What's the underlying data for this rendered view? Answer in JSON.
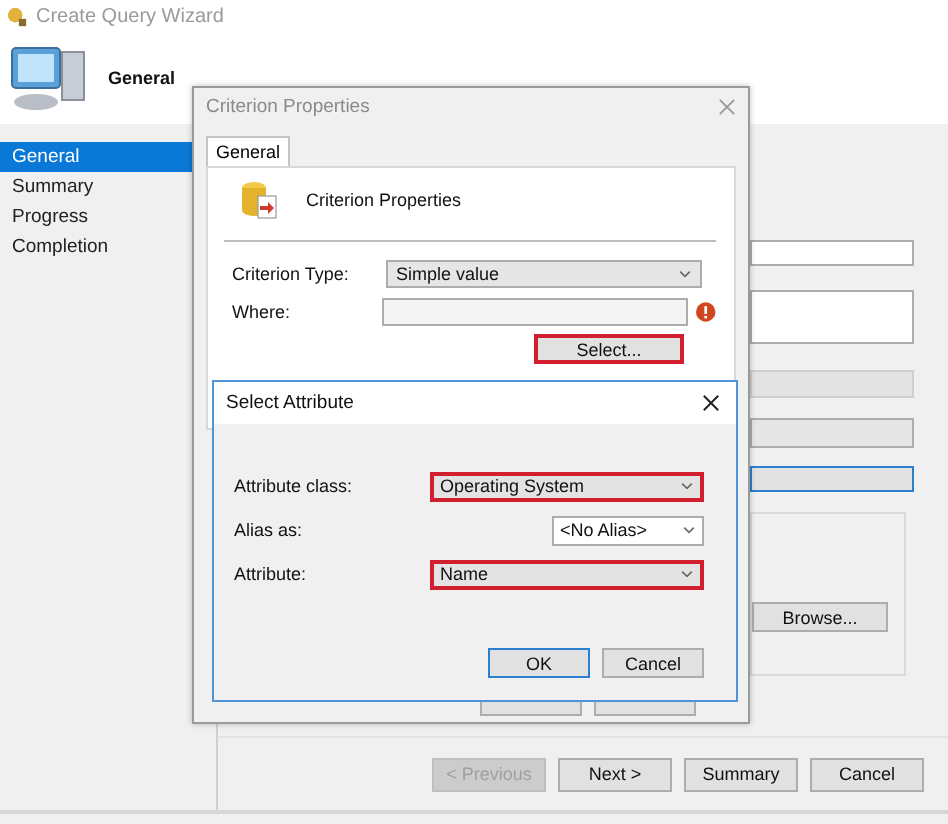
{
  "wizard": {
    "title": "Create Query Wizard",
    "header": "General",
    "nav": [
      {
        "label": "General",
        "selected": true
      },
      {
        "label": "Summary",
        "selected": false
      },
      {
        "label": "Progress",
        "selected": false
      },
      {
        "label": "Completion",
        "selected": false
      }
    ],
    "browse_button": "Browse...",
    "buttons": [
      {
        "label": "< Previous",
        "disabled": true
      },
      {
        "label": "Next >",
        "disabled": false
      },
      {
        "label": "Summary",
        "disabled": false
      },
      {
        "label": "Cancel",
        "disabled": false
      }
    ]
  },
  "criterion_dialog": {
    "title": "Criterion Properties",
    "tabs": [
      {
        "label": "General",
        "selected": true
      }
    ],
    "heading": "Criterion Properties",
    "fields": [
      {
        "label": "Criterion Type:",
        "kind": "dropdown",
        "value": "Simple value",
        "error": false
      },
      {
        "label": "Where:",
        "kind": "text",
        "error": true
      }
    ],
    "select_button": {
      "label": "Select...",
      "highlighted": true
    }
  },
  "attribute_dialog": {
    "title": "Select Attribute",
    "fields": [
      {
        "label": "Attribute class:",
        "kind": "list",
        "value": "Operating System",
        "highlighted": true
      },
      {
        "label": "Alias as:",
        "kind": "combo",
        "value": "<No Alias>",
        "highlighted": false
      },
      {
        "label": "Attribute:",
        "kind": "list",
        "value": "Name",
        "highlighted": true
      }
    ],
    "buttons": [
      {
        "label": "OK",
        "default": true
      },
      {
        "label": "Cancel",
        "default": false
      }
    ]
  }
}
